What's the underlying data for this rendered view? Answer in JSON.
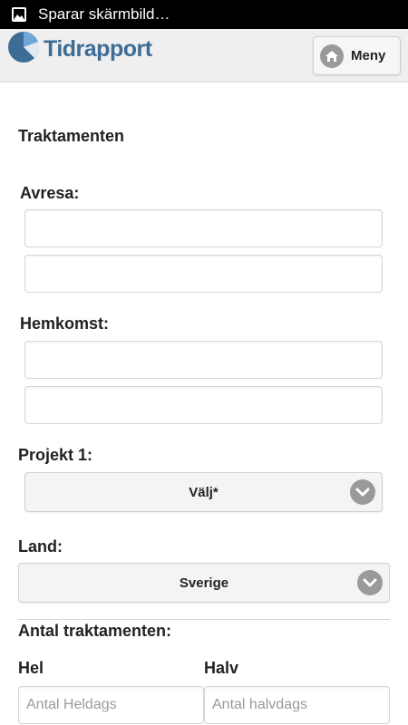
{
  "status_bar": {
    "text": "Sparar skärmbild…",
    "icon": "image-icon"
  },
  "header": {
    "logo_text": "Tidrapport",
    "menu_label": "Meny",
    "brand_color": "#3d6d96"
  },
  "page": {
    "title": "Traktamenten",
    "departure_label": "Avresa:",
    "departure_date": "",
    "departure_time": "",
    "return_label": "Hemkomst:",
    "return_date": "",
    "return_time": "",
    "project_label": "Projekt 1:",
    "project_value": "Välj*",
    "country_label": "Land:",
    "country_value": "Sverige",
    "allowances_label": "Antal traktamenten:",
    "full_label": "Hel",
    "full_placeholder": "Antal Heldags",
    "half_label": "Halv",
    "half_placeholder": "Antal halvdags"
  }
}
